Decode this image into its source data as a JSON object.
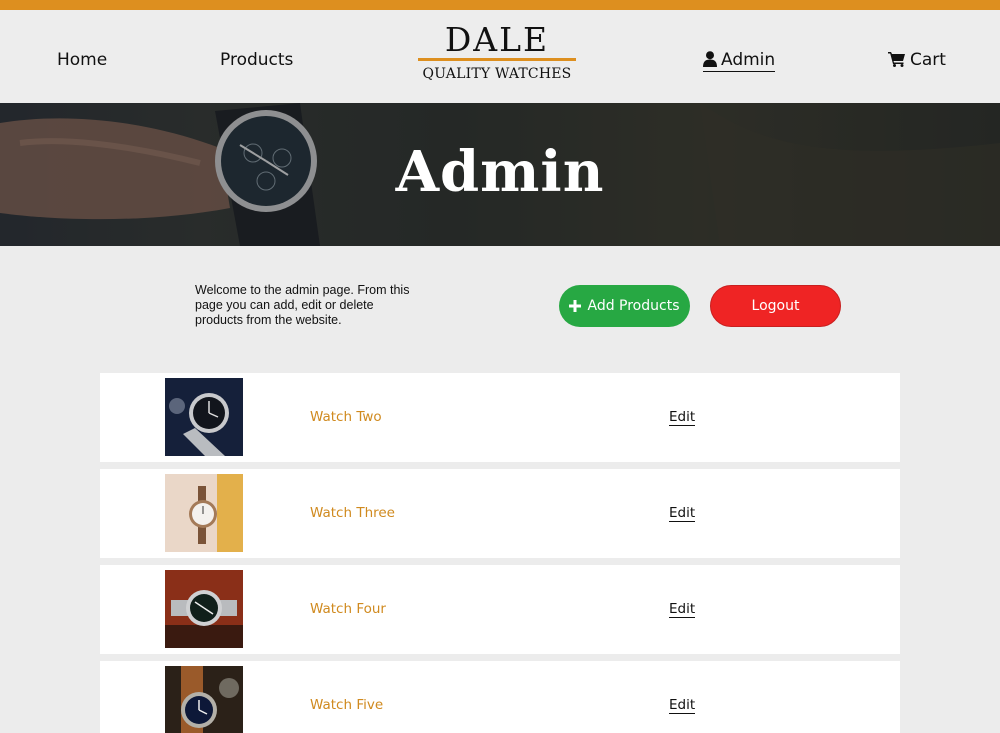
{
  "colors": {
    "accent": "#dd8f1f",
    "add_button": "#27a843",
    "logout_button": "#ef2424",
    "product_link": "#d08a1f"
  },
  "nav": {
    "home": "Home",
    "products": "Products",
    "admin": "Admin",
    "admin_icon": "user-icon",
    "cart": "Cart",
    "cart_icon": "cart-icon"
  },
  "logo": {
    "name": "DALE",
    "tagline": "QUALITY WATCHES"
  },
  "hero": {
    "title": "Admin"
  },
  "intro": {
    "text": "Welcome to the admin page. From this page you can add, edit or delete products from the website."
  },
  "actions": {
    "add_label": "Add Products",
    "add_icon": "plus-icon",
    "logout_label": "Logout"
  },
  "products": [
    {
      "name": "Watch Two",
      "edit_label": "Edit"
    },
    {
      "name": "Watch Three",
      "edit_label": "Edit"
    },
    {
      "name": "Watch Four",
      "edit_label": "Edit"
    },
    {
      "name": "Watch Five",
      "edit_label": "Edit"
    }
  ]
}
